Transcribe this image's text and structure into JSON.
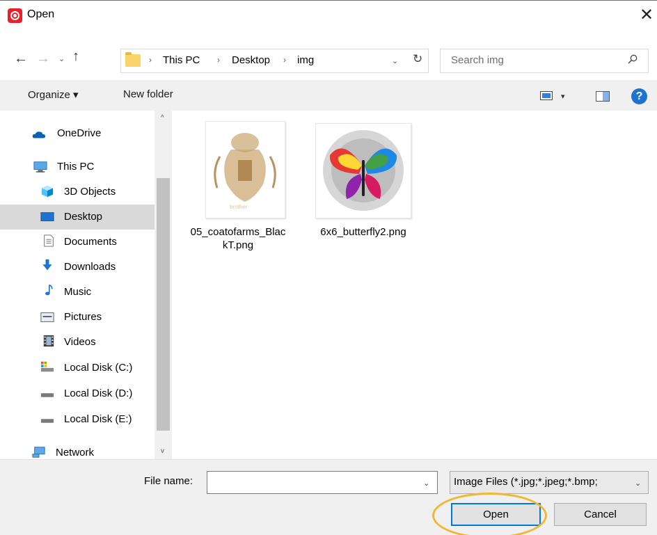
{
  "window": {
    "title": "Open",
    "close_glyph": "✕"
  },
  "address_bar": {
    "back_glyph": "←",
    "forward_glyph": "→",
    "recent_glyph": "⌄",
    "up_glyph": "↑",
    "separator": "›",
    "breadcrumbs": [
      "This PC",
      "Desktop",
      "img"
    ],
    "dropdown_glyph": "⌄",
    "refresh_glyph": "↻"
  },
  "search": {
    "placeholder": "Search img"
  },
  "command_bar": {
    "organize_label": "Organize ▾",
    "new_folder_label": "New folder",
    "view_dropdown_glyph": "▾",
    "help_label": "?"
  },
  "nav_pane": {
    "scroll_up_glyph": "^",
    "scroll_down_glyph": "v",
    "items": [
      {
        "label": "OneDrive",
        "icon": "onedrive-icon"
      },
      {
        "label": "This PC",
        "icon": "pc-icon"
      },
      {
        "label": "3D Objects",
        "icon": "3d-objects-icon"
      },
      {
        "label": "Desktop",
        "icon": "desktop-icon",
        "selected": true
      },
      {
        "label": "Documents",
        "icon": "documents-icon"
      },
      {
        "label": "Downloads",
        "icon": "downloads-icon"
      },
      {
        "label": "Music",
        "icon": "music-icon"
      },
      {
        "label": "Pictures",
        "icon": "pictures-icon"
      },
      {
        "label": "Videos",
        "icon": "videos-icon"
      },
      {
        "label": "Local Disk (C:)",
        "icon": "drive-c-icon"
      },
      {
        "label": "Local Disk (D:)",
        "icon": "drive-icon"
      },
      {
        "label": "Local Disk (E:)",
        "icon": "drive-icon"
      },
      {
        "label": "Network",
        "icon": "network-icon"
      }
    ]
  },
  "files": [
    {
      "name": "05_coatofarms_BlackT.png",
      "thumb_text": "brother"
    },
    {
      "name": "6x6_butterfly2.png"
    }
  ],
  "footer": {
    "filename_label": "File name:",
    "filename_value": "",
    "filename_dropdown_glyph": "⌄",
    "filetype_value": "Image Files (*.jpg;*.jpeg;*.bmp;",
    "filetype_arrow_glyph": "⌄",
    "open_label": "Open",
    "cancel_label": "Cancel"
  },
  "colors": {
    "accent": "#0078d7",
    "highlight_ring": "#f2b631",
    "selection": "#d9d9d9",
    "app_icon": "#e8202a"
  }
}
